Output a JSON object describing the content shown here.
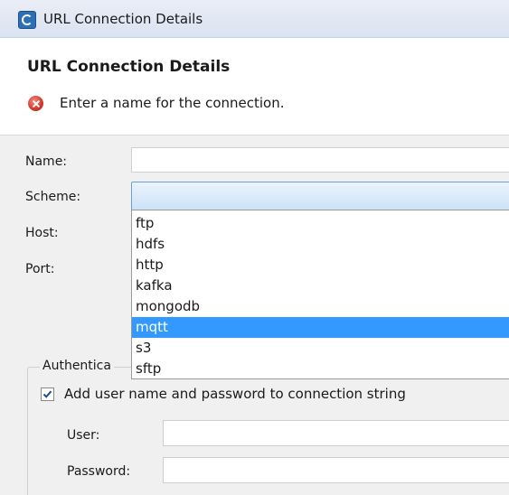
{
  "window": {
    "title": "URL Connection Details",
    "icon": "app-icon"
  },
  "header": {
    "title": "URL Connection Details",
    "error_icon": "error-icon",
    "message": "Enter a name for the connection."
  },
  "form": {
    "name_label": "Name:",
    "name_value": "",
    "scheme_label": "Scheme:",
    "scheme_value": "",
    "host_label": "Host:",
    "port_label": "Port:"
  },
  "scheme_options": [
    "ftp",
    "hdfs",
    "http",
    "kafka",
    "mongodb",
    "mqtt",
    "s3",
    "sftp"
  ],
  "scheme_highlighted": "mqtt",
  "auth": {
    "group_title": "Authentica",
    "checkbox_checked": true,
    "checkbox_label": "Add user name and password to connection string",
    "user_label": "User:",
    "user_value": "",
    "password_label": "Password:",
    "password_value": ""
  },
  "colors": {
    "selection": "#3399ff",
    "error": "#d2382a"
  }
}
